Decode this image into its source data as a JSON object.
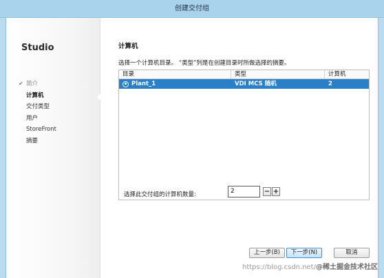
{
  "window": {
    "title": "创建交付组"
  },
  "sidebar": {
    "brand": "Studio",
    "items": [
      {
        "label": "简介",
        "state": "done"
      },
      {
        "label": "计算机",
        "state": "active"
      },
      {
        "label": "交付类型",
        "state": "pending"
      },
      {
        "label": "用户",
        "state": "pending"
      },
      {
        "label": "StoreFront",
        "state": "pending"
      },
      {
        "label": "摘要",
        "state": "pending"
      }
    ]
  },
  "main": {
    "title": "计算机",
    "description": "选择一个计算机目录。 “类型”列是在创建目录时所做选择的摘要。",
    "table": {
      "columns": [
        "目录",
        "类型",
        "计算机"
      ],
      "rows": [
        {
          "name": "Plant_1",
          "type": "VDI MCS 随机",
          "count": "2",
          "selected": true
        }
      ]
    },
    "machine_count": {
      "label": "选择此交付组的计算机数量:",
      "value": "2",
      "minus": "−",
      "plus": "+"
    }
  },
  "buttons": {
    "back": "上一步(B)",
    "next": "下一步(N)",
    "cancel": "取消"
  },
  "watermark": {
    "text": "https://blog.csdn.net/",
    "brand": "@稀土掘金技术社区"
  },
  "colors": {
    "selection": "#2a7fc9",
    "titlebar": "#a9d3ec"
  }
}
